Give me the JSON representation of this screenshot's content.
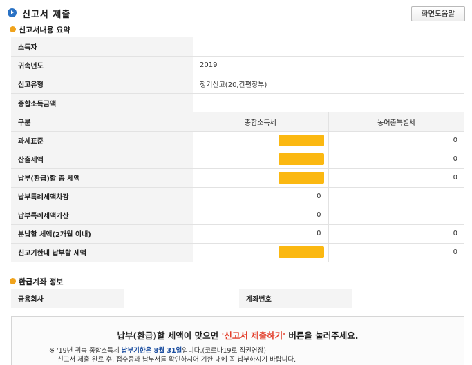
{
  "header": {
    "title": "신고서 제출",
    "help_button": "화면도움말"
  },
  "summary": {
    "section_title": "신고서내용 요약",
    "rows": {
      "taxpayer": {
        "label": "소득자",
        "value": ""
      },
      "year": {
        "label": "귀속년도",
        "value": "2019"
      },
      "report_type": {
        "label": "신고유형",
        "value": "정기신고(20,간편장부)"
      },
      "total_income": {
        "label": "종합소득금액",
        "value": ""
      }
    },
    "tax_table": {
      "col_label": "구분",
      "col_income_tax": "종합소득세",
      "col_rural_tax": "농어촌특별세",
      "rows": [
        {
          "label": "과세표준",
          "income_tax": "",
          "income_tax_masked": true,
          "rural_tax": "0"
        },
        {
          "label": "산출세액",
          "income_tax": "",
          "income_tax_masked": true,
          "rural_tax": "0"
        },
        {
          "label": "납부(환급)할 총 세액",
          "income_tax": "",
          "income_tax_masked": true,
          "rural_tax": "0"
        },
        {
          "label": "납부특례세액차감",
          "income_tax": "0",
          "income_tax_masked": false,
          "rural_tax": ""
        },
        {
          "label": "납부특례세액가산",
          "income_tax": "0",
          "income_tax_masked": false,
          "rural_tax": ""
        },
        {
          "label": "분납할 세액(2개월 이내)",
          "income_tax": "0",
          "income_tax_masked": false,
          "rural_tax": "0"
        },
        {
          "label": "신고기한내 납부할 세액",
          "income_tax": "",
          "income_tax_masked": true,
          "rural_tax": "0"
        }
      ]
    }
  },
  "refund_account": {
    "section_title": "환급계좌 정보",
    "bank_label": "금융회사",
    "bank_value": "",
    "account_label": "계좌번호",
    "account_value": ""
  },
  "notice": {
    "main_prefix": "납부(환급)할 세액이 맞으면 ",
    "main_highlight": "'신고서 제출하기'",
    "main_suffix": " 버튼을 눌러주세요.",
    "line1_a": "※ '19년 귀속 종합소득세 ",
    "line1_b": "납부기한은 8월 31일",
    "line1_c": "입니다.(코로나19로 직권연장)",
    "line2": "신고서 제출 완료 후, 접수증과 납부서를 확인하시어 기한 내에 꼭 납부하시기 바랍니다."
  }
}
